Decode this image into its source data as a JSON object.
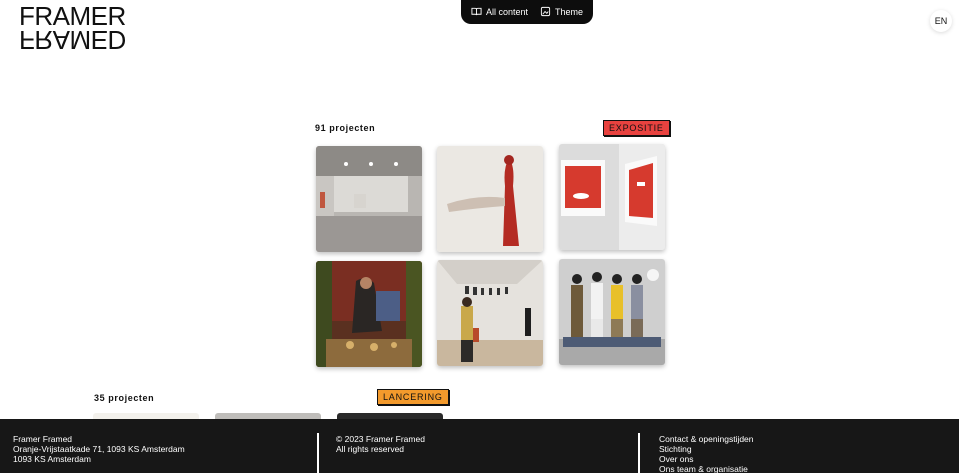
{
  "logo": {
    "line1": "FRAMER",
    "line2": "FRAMED"
  },
  "topnav": {
    "all_content": "All content",
    "theme": "Theme"
  },
  "lang": "EN",
  "sections": [
    {
      "count_label": "91 projecten",
      "tag": "EXPOSITIE",
      "tag_color": "#e8423f"
    },
    {
      "count_label": "35 projecten",
      "tag": "LANCERING",
      "tag_color": "#f39a2c"
    }
  ],
  "footer": {
    "col1": [
      "Framer Framed",
      "Oranje-Vrijstaatkade 71, 1093 KS Amsterdam",
      "1093 KS Amsterdam"
    ],
    "col2": [
      "© 2023 Framer Framed",
      "All rights reserved"
    ],
    "col3": [
      "Contact & openingstijden",
      "Stichting",
      "Over ons",
      "Ons team & organisatie"
    ]
  }
}
